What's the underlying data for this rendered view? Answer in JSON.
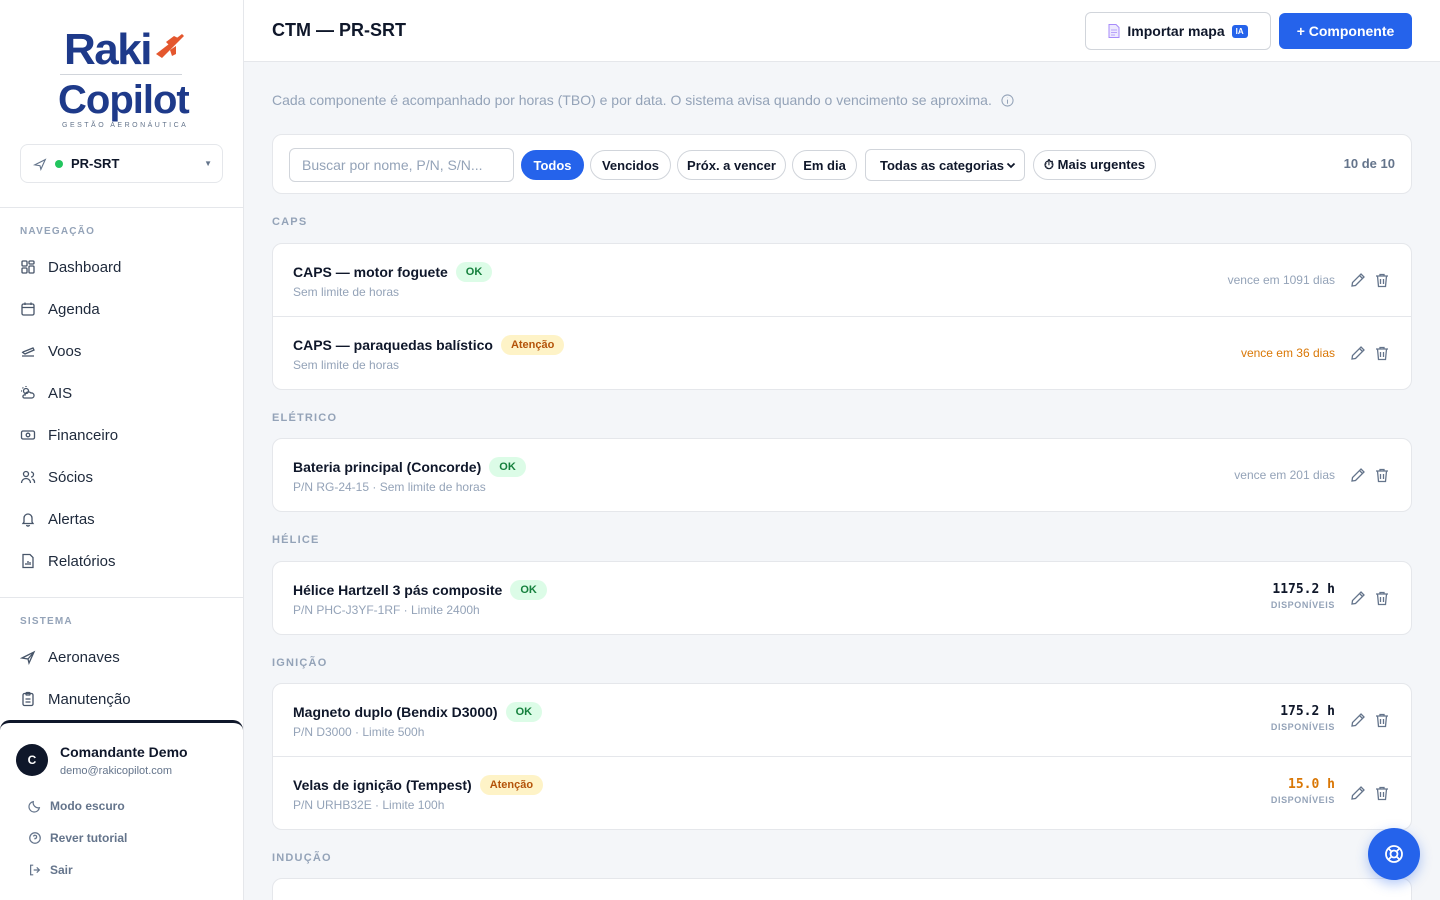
{
  "brand": {
    "line1": "Raki",
    "line2": "Copilot",
    "tagline": "GESTÃO AERONÁUTICA"
  },
  "aircraft": {
    "registration": "PR-SRT",
    "status_color": "#22c55e"
  },
  "nav": {
    "section_label": "NAVEGAÇÃO",
    "items": [
      {
        "label": "Dashboard",
        "icon": "grid-icon"
      },
      {
        "label": "Agenda",
        "icon": "calendar-icon"
      },
      {
        "label": "Voos",
        "icon": "plane-departure-icon"
      },
      {
        "label": "AIS",
        "icon": "weather-icon"
      },
      {
        "label": "Financeiro",
        "icon": "banknote-icon"
      },
      {
        "label": "Sócios",
        "icon": "users-icon"
      },
      {
        "label": "Alertas",
        "icon": "bell-icon"
      },
      {
        "label": "Relatórios",
        "icon": "file-chart-icon"
      }
    ]
  },
  "system": {
    "section_label": "SISTEMA",
    "items": [
      {
        "label": "Aeronaves",
        "icon": "plane-icon"
      },
      {
        "label": "Manutenção",
        "icon": "clipboard-icon"
      }
    ]
  },
  "user": {
    "initial": "C",
    "name": "Comandante Demo",
    "email": "demo@rakicopilot.com",
    "actions": [
      {
        "label": "Modo escuro",
        "icon": "moon-icon"
      },
      {
        "label": "Rever tutorial",
        "icon": "help-circle-icon"
      },
      {
        "label": "Sair",
        "icon": "logout-icon"
      }
    ]
  },
  "header": {
    "title": "CTM — PR-SRT",
    "import_label": "Importar mapa",
    "import_badge": "IA",
    "add_label": "+ Componente"
  },
  "intro": "Cada componente é acompanhado por horas (TBO) e por data. O sistema avisa quando o vencimento se aproxima.",
  "filters": {
    "search_placeholder": "Buscar por nome, P/N, S/N...",
    "chips": [
      "Todos",
      "Vencidos",
      "Próx. a vencer",
      "Em dia"
    ],
    "active_chip": "Todos",
    "category": "Todas as categorias",
    "sort": "⏱ Mais urgentes",
    "count": "10 de 10"
  },
  "groups": [
    {
      "label": "CAPS",
      "items": [
        {
          "name": "CAPS — motor foguete",
          "status": "OK",
          "status_kind": "ok",
          "sub": "Sem limite de horas",
          "due": "vence em 1091 dias",
          "due_kind": "normal"
        },
        {
          "name": "CAPS — paraquedas balístico",
          "status": "Atenção",
          "status_kind": "warn",
          "sub": "Sem limite de horas",
          "due": "vence em 36 dias",
          "due_kind": "warn"
        }
      ]
    },
    {
      "label": "ELÉTRICO",
      "items": [
        {
          "name": "Bateria principal (Concorde)",
          "status": "OK",
          "status_kind": "ok",
          "sub": "P/N RG-24-15 · Sem limite de horas",
          "due": "vence em 201 dias",
          "due_kind": "normal"
        }
      ]
    },
    {
      "label": "HÉLICE",
      "items": [
        {
          "name": "Hélice Hartzell 3 pás composite",
          "status": "OK",
          "status_kind": "ok",
          "sub": "P/N PHC-J3YF-1RF · Limite 2400h",
          "hours": "1175.2 h",
          "hours_label": "DISPONÍVEIS",
          "due_kind": "normal"
        }
      ]
    },
    {
      "label": "IGNIÇÃO",
      "items": [
        {
          "name": "Magneto duplo (Bendix D3000)",
          "status": "OK",
          "status_kind": "ok",
          "sub": "P/N D3000 · Limite 500h",
          "hours": "175.2 h",
          "hours_label": "DISPONÍVEIS",
          "due_kind": "normal"
        },
        {
          "name": "Velas de ignição (Tempest)",
          "status": "Atenção",
          "status_kind": "warn",
          "sub": "P/N URHB32E · Limite 100h",
          "hours": "15.0 h",
          "hours_label": "DISPONÍVEIS",
          "due_kind": "warn"
        }
      ]
    },
    {
      "label": "INDUÇÃO",
      "items": []
    }
  ],
  "colors": {
    "accent": "#2563eb",
    "ok": "#15803d",
    "warn": "#d97706",
    "brand": "#1e3a8a"
  }
}
